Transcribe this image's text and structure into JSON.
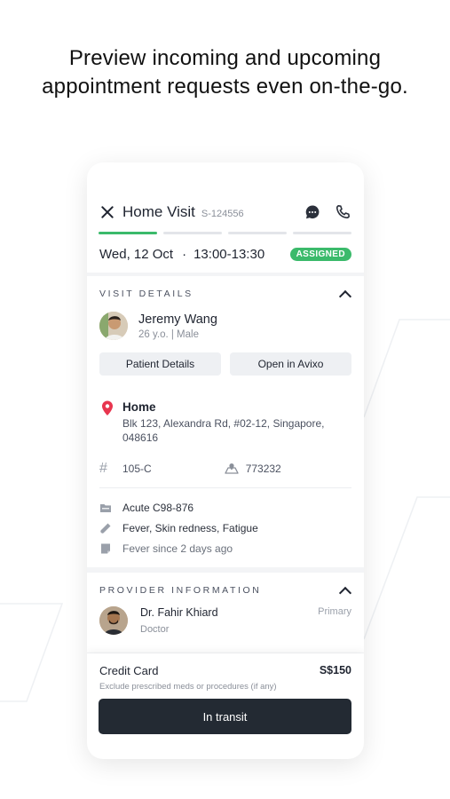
{
  "headline": {
    "line1": "Preview incoming and upcoming",
    "line2": "appointment requests even on-the-go."
  },
  "header": {
    "title": "Home Visit",
    "code": "S-124556",
    "icons": [
      "close-icon",
      "chat-icon",
      "phone-icon"
    ],
    "progress_steps_completed": 1,
    "progress_steps_total": 4
  },
  "schedule": {
    "date": "Wed, 12 Oct",
    "separator": "·",
    "time": "13:00-13:30",
    "status": "ASSIGNED"
  },
  "visit_details": {
    "section_title": "VISIT DETAILS",
    "patient": {
      "name": "Jeremy Wang",
      "meta": "26 y.o. | Male"
    },
    "buttons": {
      "patient_details": "Patient Details",
      "open_in": "Open in Avixo"
    },
    "location": {
      "label": "Home",
      "address_line1": "Blk 123, Alexandra Rd,  #02-12, Singapore,",
      "address_line2": "048616"
    },
    "unit": "105-C",
    "postal_code": "773232",
    "diagnosis": "Acute C98-876",
    "symptoms": "Fever, Skin redness, Fatigue",
    "note": "Fever since 2 days ago"
  },
  "provider_information": {
    "section_title": "PROVIDER INFORMATION",
    "doctor": {
      "name": "Dr. Fahir Khiard",
      "role": "Doctor",
      "tag": "Primary"
    }
  },
  "payment": {
    "method": "Credit Card",
    "amount": "S$150",
    "note": "Exclude prescribed meds or procedures (if any)"
  },
  "cta": {
    "label": "In transit"
  },
  "colors": {
    "accent_green": "#3bba6b",
    "cta_dark": "#232a33",
    "pin_red": "#e8364f"
  }
}
